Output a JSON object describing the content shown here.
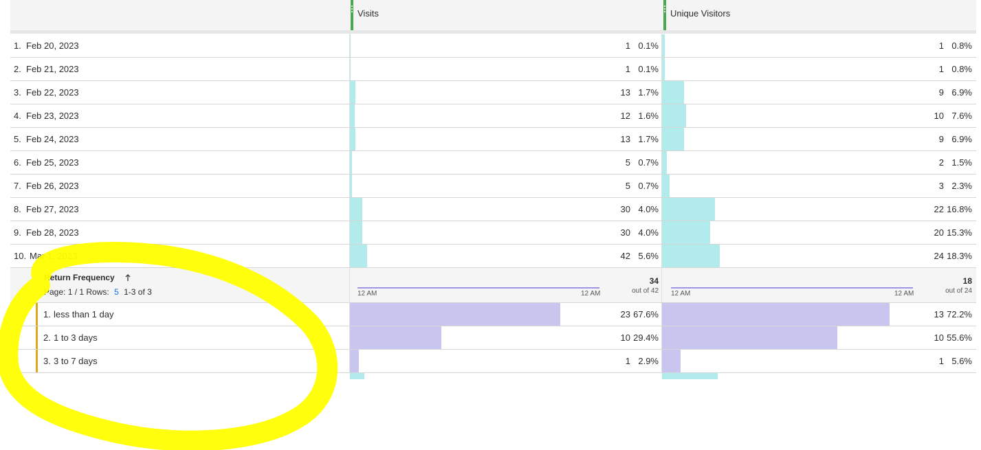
{
  "header": {
    "visits_title": "Visits",
    "unique_title": "Unique Visitors"
  },
  "rows": [
    {
      "rank": "1.",
      "label": "Feb 20, 2023",
      "visits": "1",
      "visits_pct": "0.1%",
      "visits_bar": 0.001,
      "uv": "1",
      "uv_pct": "0.8%",
      "uv_bar": 0.008
    },
    {
      "rank": "2.",
      "label": "Feb 21, 2023",
      "visits": "1",
      "visits_pct": "0.1%",
      "visits_bar": 0.001,
      "uv": "1",
      "uv_pct": "0.8%",
      "uv_bar": 0.008
    },
    {
      "rank": "3.",
      "label": "Feb 22, 2023",
      "visits": "13",
      "visits_pct": "1.7%",
      "visits_bar": 0.017,
      "uv": "9",
      "uv_pct": "6.9%",
      "uv_bar": 0.069
    },
    {
      "rank": "4.",
      "label": "Feb 23, 2023",
      "visits": "12",
      "visits_pct": "1.6%",
      "visits_bar": 0.016,
      "uv": "10",
      "uv_pct": "7.6%",
      "uv_bar": 0.076
    },
    {
      "rank": "5.",
      "label": "Feb 24, 2023",
      "visits": "13",
      "visits_pct": "1.7%",
      "visits_bar": 0.017,
      "uv": "9",
      "uv_pct": "6.9%",
      "uv_bar": 0.069
    },
    {
      "rank": "6.",
      "label": "Feb 25, 2023",
      "visits": "5",
      "visits_pct": "0.7%",
      "visits_bar": 0.007,
      "uv": "2",
      "uv_pct": "1.5%",
      "uv_bar": 0.015
    },
    {
      "rank": "7.",
      "label": "Feb 26, 2023",
      "visits": "5",
      "visits_pct": "0.7%",
      "visits_bar": 0.007,
      "uv": "3",
      "uv_pct": "2.3%",
      "uv_bar": 0.023
    },
    {
      "rank": "8.",
      "label": "Feb 27, 2023",
      "visits": "30",
      "visits_pct": "4.0%",
      "visits_bar": 0.04,
      "uv": "22",
      "uv_pct": "16.8%",
      "uv_bar": 0.168
    },
    {
      "rank": "9.",
      "label": "Feb 28, 2023",
      "visits": "30",
      "visits_pct": "4.0%",
      "visits_bar": 0.04,
      "uv": "20",
      "uv_pct": "15.3%",
      "uv_bar": 0.153
    },
    {
      "rank": "10.",
      "label": "Mar 1, 2023",
      "visits": "42",
      "visits_pct": "5.6%",
      "visits_bar": 0.056,
      "uv": "24",
      "uv_pct": "18.3%",
      "uv_bar": 0.183
    }
  ],
  "breakdown": {
    "title": "Return Frequency",
    "sort_icon": "arrow-up-icon",
    "page_label": "Page: 1 / 1",
    "rows_label": "Rows:",
    "rows_value": "5",
    "range_label": "1-3 of 3",
    "parent_label": "Mar 1, 2023",
    "visits_total": "34",
    "visits_outof": "out of 42",
    "uv_total": "18",
    "uv_outof": "out of 24",
    "axis_start": "12 AM",
    "axis_end": "12 AM",
    "items": [
      {
        "rank": "1.",
        "label": "less than 1 day",
        "visits": "23",
        "visits_pct": "67.6%",
        "visits_bar": 0.676,
        "uv": "13",
        "uv_pct": "72.2%",
        "uv_bar": 0.722
      },
      {
        "rank": "2.",
        "label": "1 to 3 days",
        "visits": "10",
        "visits_pct": "29.4%",
        "visits_bar": 0.294,
        "uv": "10",
        "uv_pct": "55.6%",
        "uv_bar": 0.556
      },
      {
        "rank": "3.",
        "label": "3 to 7 days",
        "visits": "1",
        "visits_pct": "2.9%",
        "visits_bar": 0.029,
        "uv": "1",
        "uv_pct": "5.6%",
        "uv_bar": 0.056
      }
    ]
  },
  "colors": {
    "cyan_bar": "#b2ebeb",
    "lavender_bar": "#c8c6ee",
    "column_handle": "#4aa94f",
    "breakdown_accent": "#e0a81e",
    "highlight": "#ffff00"
  }
}
